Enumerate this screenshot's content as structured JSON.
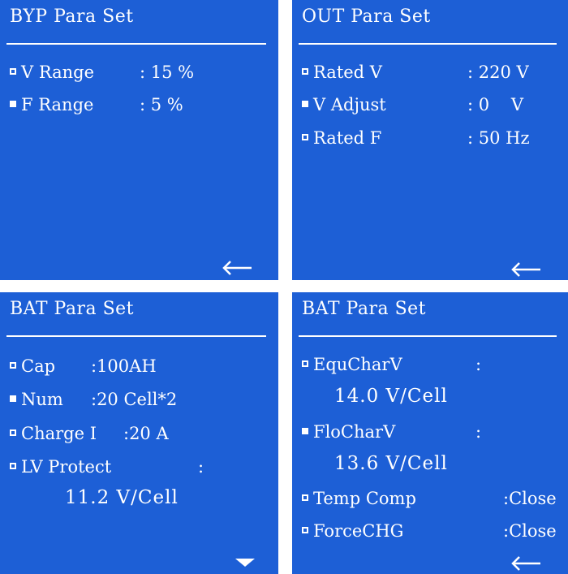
{
  "byp": {
    "title": "BYP Para Set",
    "items": [
      {
        "label": "V Range",
        "value": ": 15 %",
        "selected": false
      },
      {
        "label": "F Range",
        "value": ": 5 %",
        "selected": true
      }
    ],
    "nav_icon": "back-arrow-icon"
  },
  "out": {
    "title": "OUT Para Set",
    "items": [
      {
        "label": "Rated V",
        "value": ": 220 V",
        "selected": false
      },
      {
        "label": "V Adjust",
        "value": ": 0    V",
        "selected": true
      },
      {
        "label": "Rated F",
        "value": ": 50 Hz",
        "selected": false
      }
    ],
    "nav_icon": "back-arrow-icon"
  },
  "bat1": {
    "title": "BAT Para Set",
    "items": [
      {
        "label": "Cap",
        "value": ":100AH",
        "selected": false
      },
      {
        "label": "Num",
        "value": ":20 Cell*2",
        "selected": true
      },
      {
        "label": "Charge I",
        "value": ":20 A",
        "selected": false
      },
      {
        "label": "LV Protect",
        "value": ":",
        "selected": false
      }
    ],
    "lv_value": "11.2 V/Cell",
    "nav_icon": "down-triangle-icon"
  },
  "bat2": {
    "title": "BAT Para Set",
    "items": [
      {
        "label": "EquCharV",
        "value": ":",
        "selected": false
      },
      {
        "label": "FloCharV",
        "value": ":",
        "selected": true
      },
      {
        "label": "Temp Comp",
        "value": ":Close",
        "selected": false
      },
      {
        "label": "ForceCHG",
        "value": ":Close",
        "selected": false
      }
    ],
    "equ_value": "14.0 V/Cell",
    "flo_value": "13.6 V/Cell",
    "nav_icon": "back-arrow-icon"
  }
}
